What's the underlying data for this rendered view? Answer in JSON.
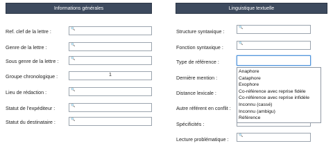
{
  "headers": {
    "left": "Informations générales",
    "right": "Linguistique textuelle"
  },
  "left_fields": [
    {
      "label": "Ref. clef de la lettre :",
      "value": ""
    },
    {
      "label": "Genre de la lettre :",
      "value": ""
    },
    {
      "label": "Sous genre de la lettre :",
      "value": ""
    },
    {
      "label": "Groupe chronologique :",
      "value": "1"
    },
    {
      "label": "Lieu de rédaction :",
      "value": ""
    },
    {
      "label": "Statut de l'expéditeur :",
      "value": ""
    },
    {
      "label": "Statut du destinataire :",
      "value": ""
    }
  ],
  "right_fields": [
    {
      "label": "Structure syntaxique :"
    },
    {
      "label": "Fonction syntaxique :"
    },
    {
      "label": "Type de référence :"
    },
    {
      "label": "Dernière mention :"
    },
    {
      "label": "Distance lexicale :"
    },
    {
      "label": "Autre référent en conflit :"
    },
    {
      "label": "Spécificités :"
    },
    {
      "label": "Lecture problématique :"
    }
  ],
  "dropdown_options": [
    "Anaphore",
    "Cataphore",
    "Exophore",
    "Co-référence avec reprise fidèle",
    "Co-référence avec reprise infidèle",
    "Inconnu (cassé)",
    "Inconnu (ambigu)",
    "Référence"
  ],
  "icons": {
    "field_icon": "magnifier-icon"
  },
  "colors": {
    "header_bg": "#3d4a5e",
    "focus_border": "#4a90d9"
  }
}
